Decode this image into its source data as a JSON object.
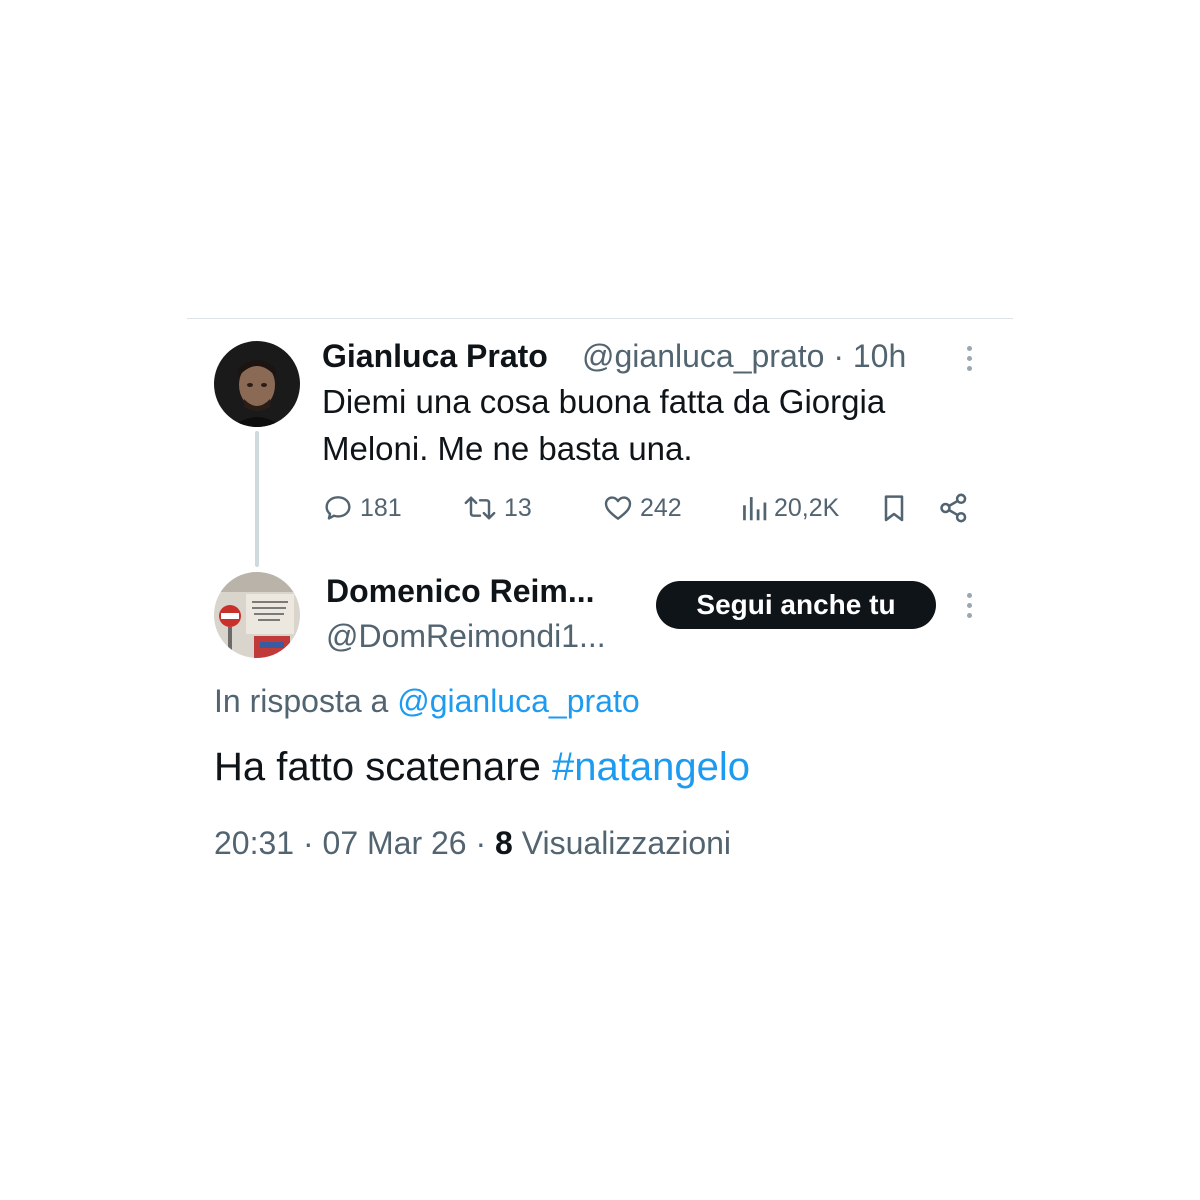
{
  "original_tweet": {
    "author_name": "Gianluca Prato",
    "author_handle": "@gianluca_prato",
    "separator": "·",
    "time": "10h",
    "text_line1": "Diemi una cosa buona fatta da Giorgia",
    "text_line2": "Meloni. Me ne basta una.",
    "stats": {
      "replies": "181",
      "reposts": "13",
      "likes": "242",
      "views": "20,2K"
    },
    "avatar_icon": "person-photo-avatar",
    "more_icon": "more-vertical-icon"
  },
  "reply_tweet": {
    "author_name": "Domenico Reim...",
    "author_handle": "@DomReimondi1...",
    "follow_label": "Segui anche tu",
    "reply_prefix": "In risposta a",
    "reply_to": "@gianluca_prato",
    "text": "Ha fatto scatenare",
    "hashtag": "#natangelo",
    "timestamp": "20:31",
    "sep1": "·",
    "date": "07 Mar 26",
    "sep2": "·",
    "views_count": "8",
    "views_label": "Visualizzazioni",
    "avatar_icon": "street-sign-photo-avatar",
    "more_icon": "more-vertical-icon"
  },
  "colors": {
    "text_primary": "#0f1419",
    "text_secondary": "#536471",
    "link": "#1d9bf0",
    "follow_button_bg": "#0f1419",
    "divider": "#dbe3e8"
  }
}
